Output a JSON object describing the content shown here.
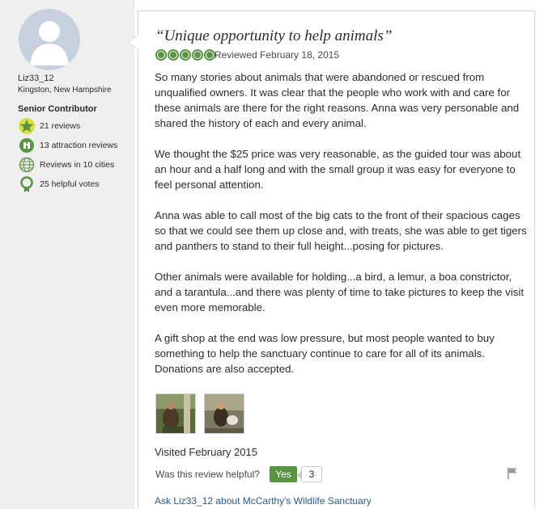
{
  "reviewer": {
    "username": "Liz33_12",
    "location": "Kingston, New Hampshire",
    "level": "Senior Contributor",
    "stats": [
      {
        "icon": "star-badge-icon",
        "label": "21 reviews"
      },
      {
        "icon": "attraction-icon",
        "label": "13 attraction reviews"
      },
      {
        "icon": "globe-icon",
        "label": "Reviews in 10 cities"
      },
      {
        "icon": "helpful-votes-icon",
        "label": "25 helpful votes"
      }
    ]
  },
  "review": {
    "title": "“Unique opportunity to help animals”",
    "rating": 5,
    "reviewed_date": "Reviewed February 18, 2015",
    "paragraphs": [
      "So many stories about animals that were abandoned or rescued from unqualified owners. It was clear that the people who work with and care for these animals are there for the right reasons. Anna was very personable and shared the history of each and every animal.",
      "We thought the $25 price was very reasonable, as the guided tour was about an hour and a half long and with the small group it was easy for everyone to feel personal attention.",
      "Anna was able to call most of the big cats to the front of their spacious cages so that we could see them up close and, with treats, she was able to get tigers and panthers to stand to their full height...posing for pictures.",
      "Other animals were available for holding...a bird, a lemur, a boa constrictor, and a tarantula...and there was plenty of time to take pictures to keep the visit even more memorable.",
      "A gift shop at the end was low pressure, but most people wanted to buy something to help the sanctuary continue to care for all of its animals. Donations are also accepted."
    ],
    "visited": "Visited February 2015",
    "helpful_question": "Was this review helpful?",
    "yes_label": "Yes",
    "helpful_count": "3",
    "ask_link": "Ask Liz33_12 about McCarthy's Wildlife Sanctuary"
  },
  "colors": {
    "accent_green": "#589442",
    "link_blue": "#2a5c85",
    "sidebar_bg": "#efefef"
  }
}
